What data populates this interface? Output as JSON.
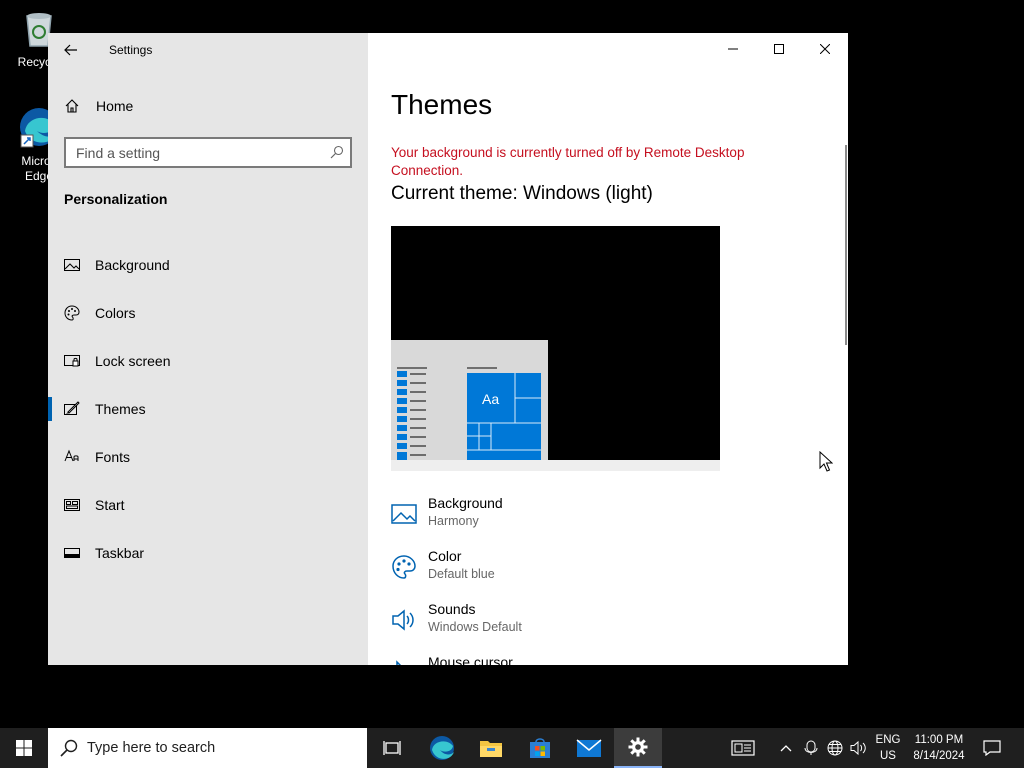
{
  "desktop": {
    "icons": [
      {
        "label": "Recycle",
        "icon": "recycle-bin-icon"
      },
      {
        "label": "Micros Edge",
        "icon": "edge-icon"
      }
    ]
  },
  "window": {
    "app_title": "Settings",
    "controls": {
      "minimize": "minimize-icon",
      "maximize": "maximize-icon",
      "close": "close-icon"
    }
  },
  "sidebar": {
    "home_label": "Home",
    "search_placeholder": "Find a setting",
    "section_title": "Personalization",
    "items": [
      {
        "label": "Background",
        "icon": "picture-icon"
      },
      {
        "label": "Colors",
        "icon": "palette-icon"
      },
      {
        "label": "Lock screen",
        "icon": "lock-screen-icon"
      },
      {
        "label": "Themes",
        "icon": "themes-brush-icon",
        "selected": true
      },
      {
        "label": "Fonts",
        "icon": "fonts-icon"
      },
      {
        "label": "Start",
        "icon": "start-tiles-icon"
      },
      {
        "label": "Taskbar",
        "icon": "taskbar-icon"
      }
    ]
  },
  "main": {
    "title": "Themes",
    "warning": "Your background is currently turned off by Remote Desktop Connection.",
    "current_theme": "Current theme: Windows (light)",
    "preview_tile_text": "Aa",
    "settings": [
      {
        "name": "Background",
        "value": "Harmony",
        "icon": "picture-icon"
      },
      {
        "name": "Color",
        "value": "Default blue",
        "icon": "palette-icon"
      },
      {
        "name": "Sounds",
        "value": "Windows Default",
        "icon": "speaker-icon"
      },
      {
        "name": "Mouse cursor",
        "value": "",
        "icon": "cursor-icon"
      }
    ]
  },
  "taskbar": {
    "search_placeholder": "Type here to search",
    "language_top": "ENG",
    "language_bottom": "US",
    "time": "11:00 PM",
    "date": "8/14/2024",
    "accent": "#0078d7"
  }
}
